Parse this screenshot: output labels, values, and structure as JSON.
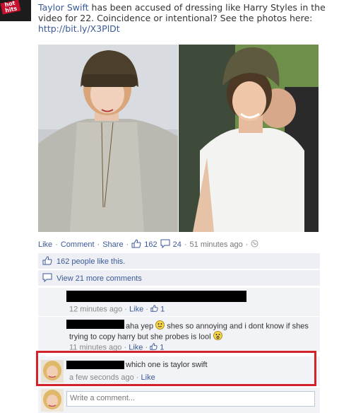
{
  "post": {
    "author": "Taylor Swift",
    "text": " has been accused of dressing like Harry Styles in the video for 22. Coincidence or intentional? See the photos here:",
    "url": "http://bit.ly/X3PlDt",
    "logo_text": [
      "hot",
      "hits"
    ],
    "photos": [
      "taylor-swift-beanie-photo",
      "harry-styles-beanie-photo"
    ]
  },
  "actions": {
    "like": "Like",
    "comment": "Comment",
    "share": "Share",
    "like_count": "162",
    "comment_count": "24",
    "time": "51 minutes ago",
    "separator": "·"
  },
  "ufi": {
    "likes_text": "162 people like this.",
    "view_more": "View 21 more comments"
  },
  "comments": [
    {
      "text": "",
      "time": "12 minutes ago",
      "like_label": "Like",
      "likes": "1"
    },
    {
      "text_line1": "aha yep",
      "text_line1b": " shes so annoying and i dont know if shes",
      "text_line2": "trying to copy harry but she probes is lool",
      "time": "11 minutes ago",
      "like_label": "Like",
      "likes": "1"
    },
    {
      "text": "which one is taylor swift",
      "time": "a few seconds ago",
      "like_label": "Like"
    }
  ],
  "composer": {
    "placeholder": "Write a comment..."
  },
  "colors": {
    "link": "#3b5998",
    "ufi_bg": "#edeff4",
    "highlight": "#d2232a"
  }
}
